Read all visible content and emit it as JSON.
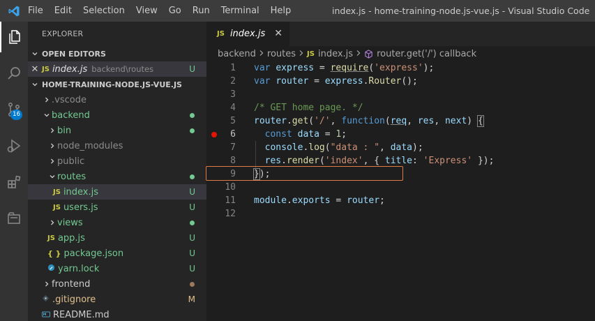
{
  "menu": [
    "File",
    "Edit",
    "Selection",
    "View",
    "Go",
    "Run",
    "Terminal",
    "Help"
  ],
  "window_title": "index.js - home-training-node.js-vue.js - Visual Studio Code",
  "activity": {
    "items": [
      "explorer-icon",
      "search-icon",
      "source-control-icon",
      "run-debug-icon",
      "extensions-icon",
      "remote-explorer-icon"
    ],
    "scm_badge": "16"
  },
  "sidebar": {
    "title": "EXPLORER",
    "open_editors": {
      "header": "OPEN EDITORS",
      "items": [
        {
          "close": "✕",
          "icon": "JS",
          "name": "index.js",
          "path": "backend\\routes",
          "status": "U"
        }
      ]
    },
    "project": {
      "header": "HOME-TRAINING-NODE.JS-VUE.JS",
      "tree": [
        {
          "name": ".vscode",
          "kind": "folder",
          "expanded": false,
          "indent": 0
        },
        {
          "name": "backend",
          "kind": "folder",
          "expanded": true,
          "indent": 0,
          "status": "dot",
          "color": "#73c991"
        },
        {
          "name": "bin",
          "kind": "folder",
          "expanded": false,
          "indent": 1,
          "status": "dot",
          "color": "#73c991"
        },
        {
          "name": "node_modules",
          "kind": "folder",
          "expanded": false,
          "indent": 1
        },
        {
          "name": "public",
          "kind": "folder",
          "expanded": false,
          "indent": 1
        },
        {
          "name": "routes",
          "kind": "folder",
          "expanded": true,
          "indent": 1,
          "status": "dot",
          "color": "#73c991"
        },
        {
          "name": "index.js",
          "kind": "js",
          "indent": 2,
          "status": "U",
          "selected": true
        },
        {
          "name": "users.js",
          "kind": "js",
          "indent": 2,
          "status": "U"
        },
        {
          "name": "views",
          "kind": "folder",
          "expanded": false,
          "indent": 1,
          "status": "dot",
          "color": "#73c991"
        },
        {
          "name": "app.js",
          "kind": "js",
          "indent": 1,
          "status": "U"
        },
        {
          "name": "package.json",
          "kind": "json",
          "indent": 1,
          "status": "U"
        },
        {
          "name": "yarn.lock",
          "kind": "yarn",
          "indent": 1,
          "status": "U"
        },
        {
          "name": "frontend",
          "kind": "folder",
          "expanded": false,
          "indent": 0,
          "status": "dot",
          "color": "#9e7a5b"
        },
        {
          "name": ".gitignore",
          "kind": "git",
          "indent": 0,
          "status": "M"
        },
        {
          "name": "README.md",
          "kind": "md",
          "indent": 0
        }
      ]
    }
  },
  "editor": {
    "tab": {
      "icon": "JS",
      "label": "index.js",
      "close": "✕"
    },
    "breadcrumbs": [
      "backend",
      "routes",
      "index.js",
      "router.get('/') callback"
    ],
    "breakpoint_line": 6,
    "lines": [
      {
        "n": "1",
        "tokens": [
          [
            "kw",
            "var "
          ],
          [
            "var",
            "express"
          ],
          [
            "pl",
            " = "
          ],
          [
            "fn under",
            "require"
          ],
          [
            "pl",
            "("
          ],
          [
            "str",
            "'express'"
          ],
          [
            "pl",
            ");"
          ]
        ]
      },
      {
        "n": "2",
        "tokens": [
          [
            "kw",
            "var "
          ],
          [
            "var",
            "router"
          ],
          [
            "pl",
            " = "
          ],
          [
            "var",
            "express"
          ],
          [
            "pl",
            "."
          ],
          [
            "fn",
            "Router"
          ],
          [
            "pl",
            "();"
          ]
        ]
      },
      {
        "n": "3",
        "tokens": []
      },
      {
        "n": "4",
        "tokens": [
          [
            "cmt",
            "/* GET home page. */"
          ]
        ]
      },
      {
        "n": "5",
        "tokens": [
          [
            "var",
            "router"
          ],
          [
            "pl",
            "."
          ],
          [
            "fn",
            "get"
          ],
          [
            "pl",
            "("
          ],
          [
            "str",
            "'/'"
          ],
          [
            "pl",
            ", "
          ],
          [
            "kw",
            "function"
          ],
          [
            "pl",
            "("
          ],
          [
            "var under",
            "req"
          ],
          [
            "pl",
            ", "
          ],
          [
            "var",
            "res"
          ],
          [
            "pl",
            ", "
          ],
          [
            "var",
            "next"
          ],
          [
            "pl",
            ") "
          ],
          [
            "pl bracket-box",
            "{"
          ]
        ]
      },
      {
        "n": "6",
        "tokens": [
          [
            "pl",
            "  "
          ],
          [
            "kw",
            "const "
          ],
          [
            "var",
            "data"
          ],
          [
            "pl",
            " = "
          ],
          [
            "num",
            "1"
          ],
          [
            "pl",
            ";"
          ]
        ]
      },
      {
        "n": "7",
        "tokens": [
          [
            "pl",
            "  "
          ],
          [
            "var",
            "console"
          ],
          [
            "pl",
            "."
          ],
          [
            "fn",
            "log"
          ],
          [
            "pl",
            "("
          ],
          [
            "str",
            "\"data : \""
          ],
          [
            "pl",
            ", "
          ],
          [
            "var",
            "data"
          ],
          [
            "pl",
            ");"
          ]
        ]
      },
      {
        "n": "8",
        "tokens": [
          [
            "pl",
            "  "
          ],
          [
            "var",
            "res"
          ],
          [
            "pl",
            "."
          ],
          [
            "fn",
            "render"
          ],
          [
            "pl",
            "("
          ],
          [
            "str",
            "'index'"
          ],
          [
            "pl",
            ", { "
          ],
          [
            "var",
            "title"
          ],
          [
            "pl",
            ": "
          ],
          [
            "str",
            "'Express'"
          ],
          [
            "pl",
            " });"
          ]
        ]
      },
      {
        "n": "9",
        "tokens": [
          [
            "pl bracket-box",
            "}"
          ],
          [
            "pl",
            ");"
          ]
        ]
      },
      {
        "n": "10",
        "tokens": []
      },
      {
        "n": "11",
        "tokens": [
          [
            "var",
            "module"
          ],
          [
            "pl",
            "."
          ],
          [
            "var",
            "exports"
          ],
          [
            "pl",
            " = "
          ],
          [
            "var",
            "router"
          ],
          [
            "pl",
            ";"
          ]
        ]
      },
      {
        "n": "12",
        "tokens": []
      }
    ]
  }
}
